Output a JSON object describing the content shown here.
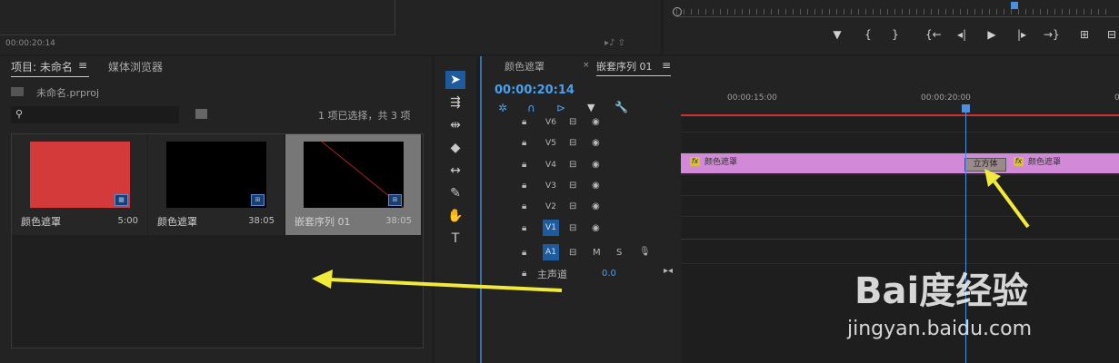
{
  "top": {
    "timecode": "00:00:20:14"
  },
  "project_panel": {
    "tab_project": "项目: 未命名",
    "tab_media": "媒体浏览器",
    "project_file": "未命名.prproj",
    "selection_info": "1 项已选择，共 3 项",
    "items": [
      {
        "name": "颜色遮罩",
        "duration": "5:00",
        "thumb_color": "#d43a3a"
      },
      {
        "name": "颜色遮罩",
        "duration": "38:05",
        "thumb_color": "#000000"
      },
      {
        "name": "嵌套序列 01",
        "duration": "38:05",
        "thumb_color": "#000000"
      }
    ]
  },
  "timeline": {
    "tab_1": "颜色遮罩",
    "tab_2": "嵌套序列 01",
    "timecode": "00:00:20:14",
    "ruler_1": "00:00:15:00",
    "ruler_2": "00:00:20:00",
    "ruler_3": "0",
    "tracks": [
      "V6",
      "V5",
      "V4",
      "V3",
      "V2",
      "V1",
      "A1"
    ],
    "mix_label": "主声道",
    "mix_value": "0.0",
    "m_label": "M",
    "s_label": "S",
    "clip_label_1": "颜色遮罩",
    "clip_label_2": "颜色遮罩",
    "clip_tip": "立方体",
    "fx": "fx"
  },
  "watermark": {
    "brand": "Bai度经验",
    "url": "jingyan.baidu.com"
  },
  "colors": {
    "accent": "#4aa0f0",
    "clip": "#d28ad8",
    "arrow": "#f2ea3a",
    "redline": "#d03030"
  }
}
